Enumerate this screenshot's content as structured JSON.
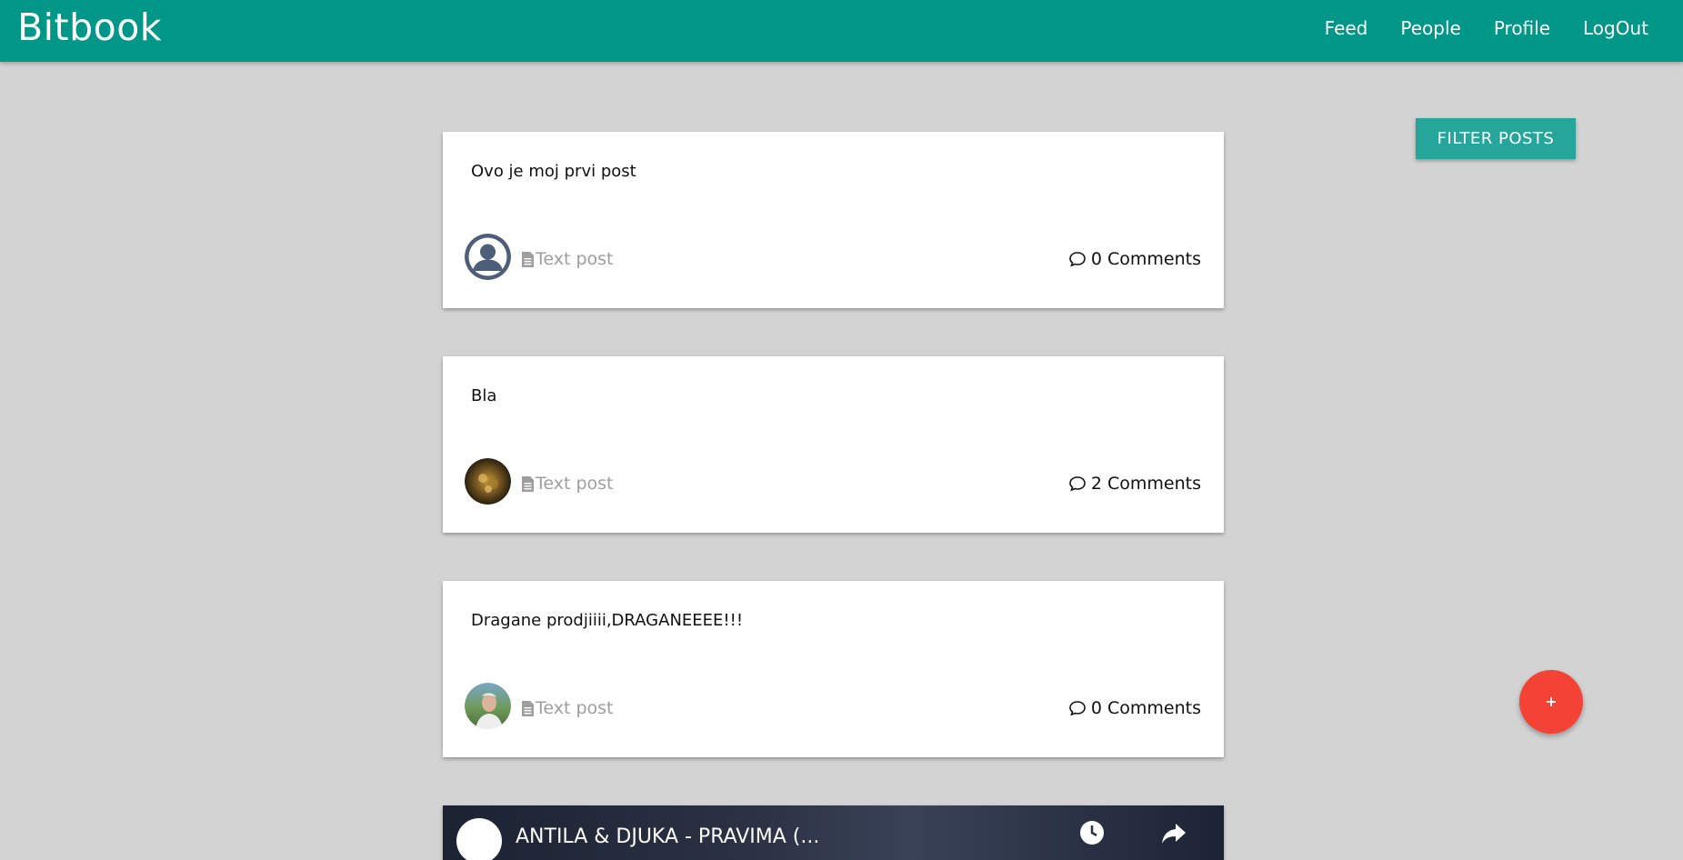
{
  "app": {
    "brand": "Bitbook",
    "accent_color": "#009688",
    "background_color": "#d3d3d3"
  },
  "nav": {
    "items": [
      {
        "label": "Feed"
      },
      {
        "label": "People"
      },
      {
        "label": "Profile"
      },
      {
        "label": "LogOut"
      }
    ]
  },
  "filter": {
    "label": "FILTER POSTS",
    "color": "#26a69a"
  },
  "posts": [
    {
      "text": "Ovo je moj prvi post",
      "type_icon": "document-icon",
      "type_label": "Text post",
      "comment_icon": "comment-bubble-icon",
      "comments_label": "0 Comments",
      "avatar": "default-user-avatar"
    },
    {
      "text": "Bla",
      "type_icon": "document-icon",
      "type_label": "Text post",
      "comment_icon": "comment-bubble-icon",
      "comments_label": "2 Comments",
      "avatar": "photo-avatar"
    },
    {
      "text": "Dragane prodjiiii,DRAGANEEEE!!!",
      "type_icon": "document-icon",
      "type_label": "Text post",
      "comment_icon": "comment-bubble-icon",
      "comments_label": "0 Comments",
      "avatar": "photo-avatar"
    }
  ],
  "video_post": {
    "title": "ANTILA & DJUKA - PRAVIMA (...",
    "icons": [
      "channel-logo-icon",
      "clock-icon",
      "share-icon"
    ]
  },
  "fab": {
    "label": "+",
    "color": "#f44336"
  }
}
